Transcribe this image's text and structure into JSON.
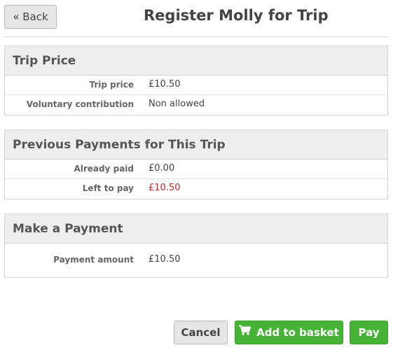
{
  "header": {
    "back_label": "« Back",
    "title": "Register Molly for Trip"
  },
  "sections": {
    "trip_price": {
      "heading": "Trip Price",
      "rows": [
        {
          "label": "Trip price",
          "value": "£10.50"
        },
        {
          "label": "Voluntary contribution",
          "value": "Non allowed"
        }
      ]
    },
    "previous_payments": {
      "heading": "Previous Payments for This Trip",
      "rows": [
        {
          "label": "Already paid",
          "value": "£0.00"
        },
        {
          "label": "Left to pay",
          "value": "£10.50"
        }
      ]
    },
    "make_payment": {
      "heading": "Make a Payment",
      "rows": [
        {
          "label": "Payment amount",
          "value": "£10.50"
        }
      ]
    }
  },
  "actions": {
    "cancel_label": "Cancel",
    "add_to_basket_label": "Add to basket",
    "add_to_basket_icon": "shopping-cart-icon",
    "pay_label": "Pay"
  },
  "colors": {
    "accent_green": "#47b336",
    "warning_red": "#c0262b",
    "panel_header_bg": "#eeeeee"
  }
}
